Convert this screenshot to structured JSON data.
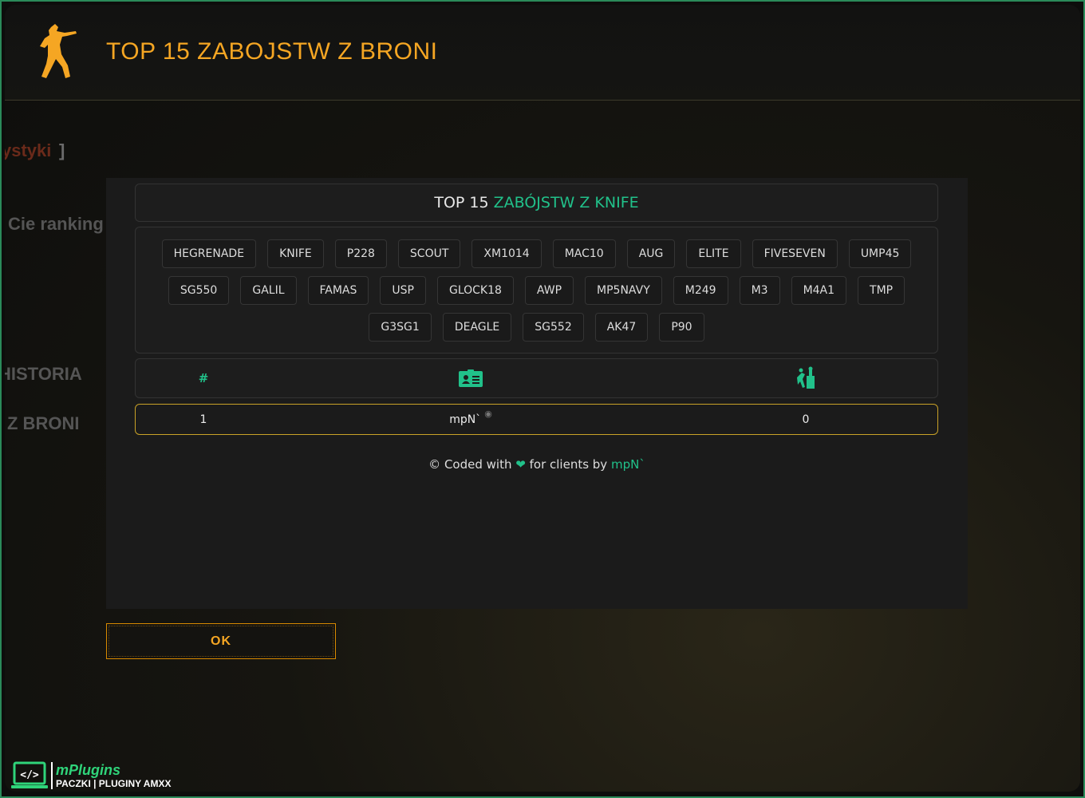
{
  "header": {
    "title": "TOP 15 ZABOJSTW Z BRONI"
  },
  "background_fragments": {
    "stats_link": "ystyki",
    "stats_bracket": "]",
    "ranking_text": "Cie ranking",
    "history": "HISTORIA",
    "weapons": "Z BRONI"
  },
  "modal": {
    "title_prefix": "TOP 15",
    "title_accent": "ZABÓJSTW Z KNIFE",
    "weapon_rows": [
      [
        "HEGRENADE",
        "KNIFE",
        "P228",
        "SCOUT",
        "XM1014",
        "MAC10",
        "AUG",
        "ELITE",
        "FIVESEVEN",
        "UMP45"
      ],
      [
        "SG550",
        "GALIL",
        "FAMAS",
        "USP",
        "GLOCK18",
        "AWP",
        "MP5NAVY",
        "M249",
        "M3",
        "M4A1",
        "TMP"
      ],
      [
        "G3SG1",
        "DEAGLE",
        "SG552",
        "AK47",
        "P90"
      ]
    ],
    "table_header": {
      "rank": "#",
      "player_icon": "id-card-icon",
      "kills_icon": "kill-icon"
    },
    "rows": [
      {
        "rank": "1",
        "player": "mpN`",
        "kills": "0"
      }
    ],
    "footer": {
      "prefix": "© Coded with",
      "heart": "❤",
      "middle": "for clients by",
      "author": "mpN`"
    }
  },
  "ok_button": {
    "label": "OK"
  },
  "watermark": {
    "brand": "mPlugins",
    "subtitle": "PACZKI | PLUGINY AMXX"
  },
  "colors": {
    "accent": "#21c18a",
    "header_title": "#f5a623",
    "row_border": "#c9a227"
  }
}
